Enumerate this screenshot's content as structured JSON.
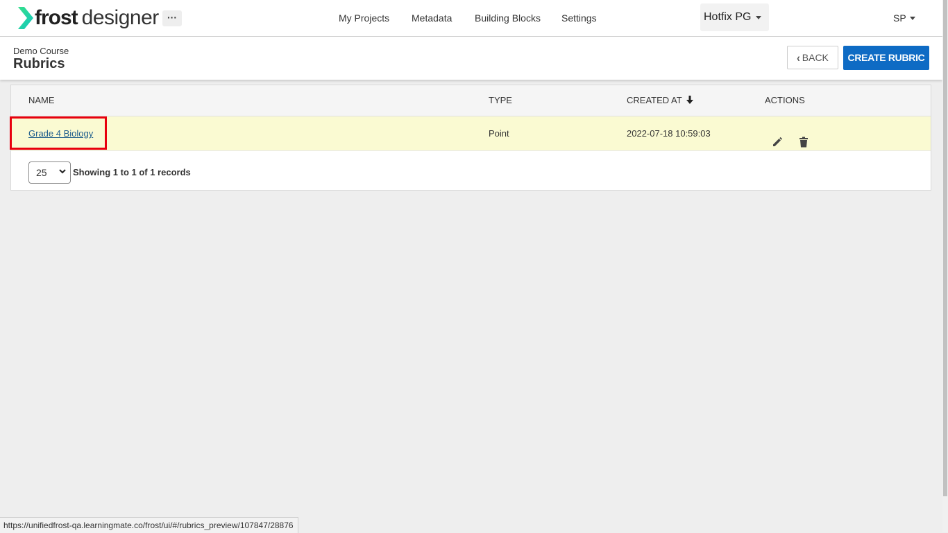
{
  "brand": {
    "name_bold": "frost",
    "name_light": "designer",
    "accent": "#1bd1a5"
  },
  "topnav": {
    "more_label": "···",
    "items": [
      {
        "label": "My Projects"
      },
      {
        "label": "Metadata"
      },
      {
        "label": "Building Blocks"
      },
      {
        "label": "Settings"
      }
    ],
    "project_label": "Hotfix PG",
    "user_label": "SP"
  },
  "header": {
    "course": "Demo Course",
    "title": "Rubrics",
    "back_label": "BACK",
    "create_label": "CREATE RUBRIC",
    "primary_color": "#0e6bc4"
  },
  "table": {
    "columns": [
      "NAME",
      "TYPE",
      "CREATED AT",
      "ACTIONS"
    ],
    "sort_icon": "arrow-down-icon",
    "rows": [
      {
        "name": "Grade 4 Biology",
        "type": "Point",
        "created_at": "2022-07-18 10:59:03"
      }
    ],
    "row_highlight": "#fafad2"
  },
  "pagination": {
    "page_size": "25",
    "records_text": "Showing 1 to 1 of 1 records"
  },
  "status_bar": {
    "url": "https://unifiedfrost-qa.learningmate.co/frost/ui/#/rubrics_preview/107847/28876"
  }
}
